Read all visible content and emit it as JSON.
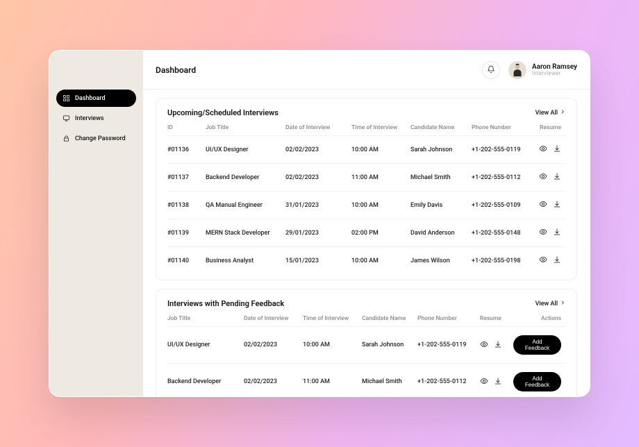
{
  "header": {
    "title": "Dashboard",
    "user_name": "Aaron Ramsey",
    "user_role": "Interviewer"
  },
  "sidebar": {
    "items": [
      {
        "label": "Dashboard",
        "icon": "grid-icon",
        "active": true
      },
      {
        "label": "Interviews",
        "icon": "display-icon",
        "active": false
      },
      {
        "label": "Change Password",
        "icon": "lock-icon",
        "active": false
      }
    ]
  },
  "upcoming": {
    "title": "Upcoming/Scheduled Interviews",
    "view_all_label": "View All",
    "columns": {
      "id": "ID",
      "job": "Job Title",
      "date": "Date of Interview",
      "time": "Time of Interview",
      "candidate": "Candidate Name",
      "phone": "Phone Number",
      "resume": "Resume"
    },
    "rows": [
      {
        "id": "#01136",
        "job": "UI/UX Designer",
        "date": "02/02/2023",
        "time": "10:00 AM",
        "candidate": "Sarah Johnson",
        "phone": "+1-202-555-0119"
      },
      {
        "id": "#01137",
        "job": "Backend Developer",
        "date": "02/02/2023",
        "time": "11:00 AM",
        "candidate": "Michael Smith",
        "phone": "+1-202-555-0112"
      },
      {
        "id": "#01138",
        "job": "QA Manual Engineer",
        "date": "31/01/2023",
        "time": "10:00 AM",
        "candidate": "Emily Davis",
        "phone": "+1-202-555-0109"
      },
      {
        "id": "#01139",
        "job": "MERN Stack Developer",
        "date": "29/01/2023",
        "time": "02:00 PM",
        "candidate": "David Anderson",
        "phone": "+1-202-555-0148"
      },
      {
        "id": "#01140",
        "job": "Business Analyst",
        "date": "15/01/2023",
        "time": "10:00 AM",
        "candidate": "James Wilson",
        "phone": "+1-202-555-0198"
      }
    ]
  },
  "pending": {
    "title": "Interviews with Pending Feedback",
    "view_all_label": "View All",
    "columns": {
      "job": "Job Title",
      "date": "Date of Interview",
      "time": "Time of Interview",
      "candidate": "Candidate Name",
      "phone": "Phone Number",
      "resume": "Resume",
      "actions": "Actions"
    },
    "action_label": "Add Feedback",
    "rows": [
      {
        "job": "UI/UX Designer",
        "date": "02/02/2023",
        "time": "10:00 AM",
        "candidate": "Sarah Johnson",
        "phone": "+1-202-555-0119"
      },
      {
        "job": "Backend Developer",
        "date": "02/02/2023",
        "time": "11:00 AM",
        "candidate": "Michael Smith",
        "phone": "+1-202-555-0112"
      }
    ]
  }
}
